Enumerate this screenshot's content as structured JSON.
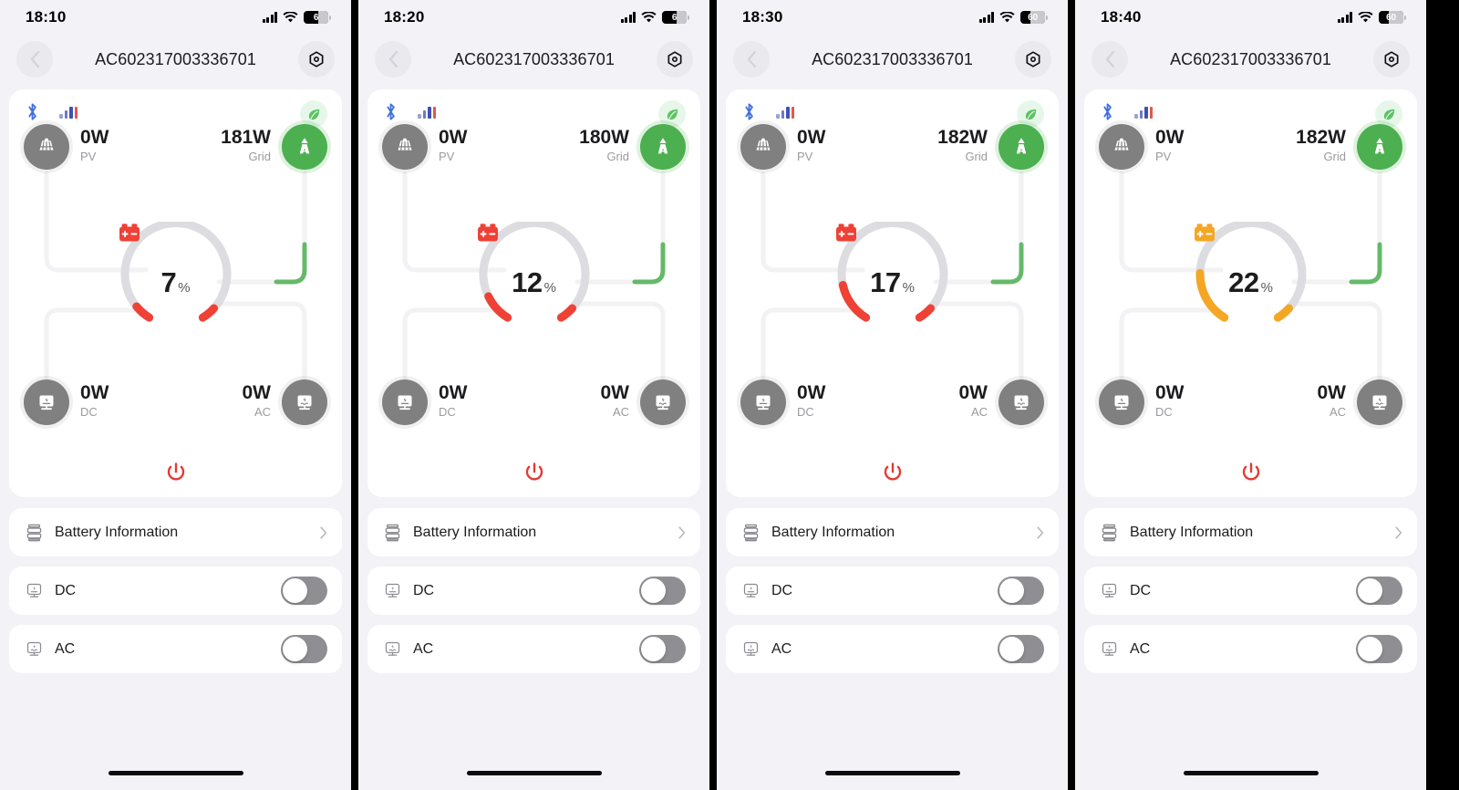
{
  "device": {
    "title": "AC602317003336701",
    "back_icon": "chevron-left-icon",
    "settings_icon": "gear-hex-icon"
  },
  "labels": {
    "pv": "PV",
    "grid": "Grid",
    "dc": "DC",
    "ac": "AC",
    "percent_symbol": "%",
    "battery_information": "Battery Information",
    "row_dc": "DC",
    "row_ac": "AC"
  },
  "icons": {
    "bluetooth": "bluetooth-icon",
    "signal": "signal-bars-icon",
    "leaf": "leaf-icon",
    "pv_node": "solar-panel-icon",
    "grid_node": "power-pylon-icon",
    "dc_node": "dc-output-icon",
    "ac_node": "ac-output-icon",
    "battery_gauge": "battery-plus-minus-icon",
    "power": "power-button-icon",
    "battery_info": "battery-stack-icon",
    "chevron_right": "chevron-right-icon",
    "wifi": "wifi-icon",
    "cellular": "cellular-bars-icon",
    "battery_status": "battery-status-icon"
  },
  "colors": {
    "accent_green": "#4caf50",
    "battery_low_red": "#ef4136",
    "battery_mid_orange": "#f5a623",
    "toggle_off": "#8e8e93",
    "node_gray": "#808080",
    "page_bg": "#f2f2f7",
    "card_bg": "#ffffff"
  },
  "panels": [
    {
      "status": {
        "time": "18:10",
        "battery_text": "6",
        "battery_level_pct": 58
      },
      "pv": "0W",
      "grid": "181W",
      "dc": "0W",
      "ac": "0W",
      "battery_percent": "7",
      "battery_percent_value": 7,
      "gauge_color": "#ef4136",
      "battery_icon_color": "#ef4136",
      "toggles": {
        "dc": "off",
        "ac": "off"
      }
    },
    {
      "status": {
        "time": "18:20",
        "battery_text": "6",
        "battery_level_pct": 58
      },
      "pv": "0W",
      "grid": "180W",
      "dc": "0W",
      "ac": "0W",
      "battery_percent": "12",
      "battery_percent_value": 12,
      "gauge_color": "#ef4136",
      "battery_icon_color": "#ef4136",
      "toggles": {
        "dc": "off",
        "ac": "off"
      }
    },
    {
      "status": {
        "time": "18:30",
        "battery_text": "60",
        "battery_level_pct": 40
      },
      "pv": "0W",
      "grid": "182W",
      "dc": "0W",
      "ac": "0W",
      "battery_percent": "17",
      "battery_percent_value": 17,
      "gauge_color": "#ef4136",
      "battery_icon_color": "#ef4136",
      "toggles": {
        "dc": "off",
        "ac": "off"
      }
    },
    {
      "status": {
        "time": "18:40",
        "battery_text": "60",
        "battery_level_pct": 40
      },
      "pv": "0W",
      "grid": "182W",
      "dc": "0W",
      "ac": "0W",
      "battery_percent": "22",
      "battery_percent_value": 22,
      "gauge_color": "#f5a623",
      "battery_icon_color": "#f5a623",
      "toggles": {
        "dc": "off",
        "ac": "off"
      }
    }
  ]
}
